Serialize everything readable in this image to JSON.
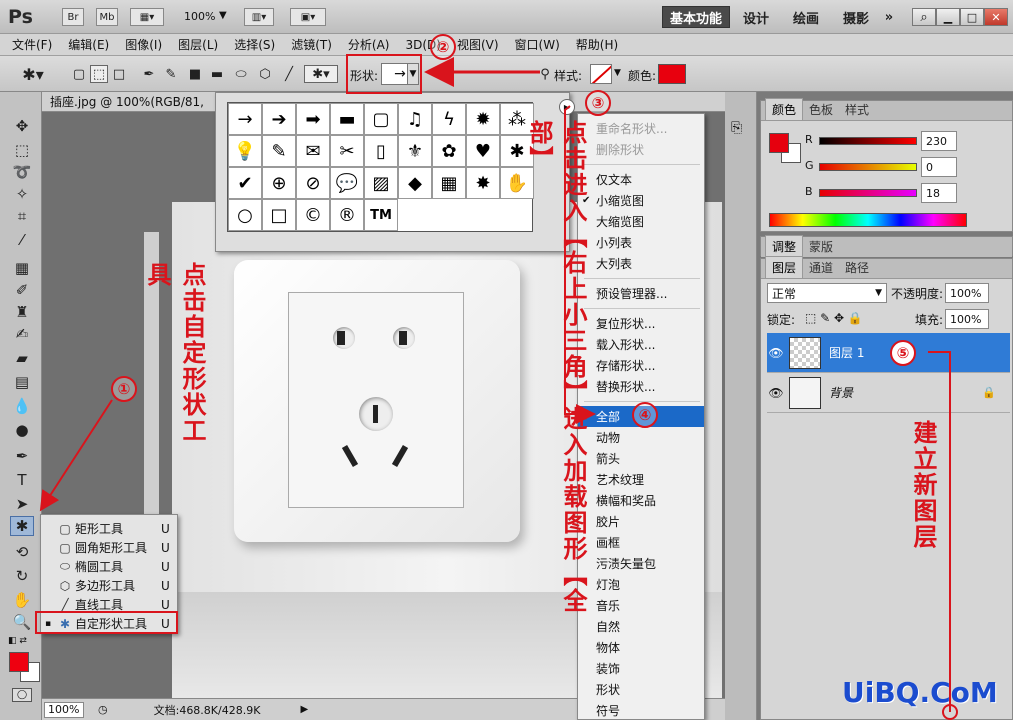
{
  "app": {
    "logo": "Ps",
    "bridge": "Br",
    "minibridge": "Mb",
    "zoom": "100%",
    "workspaces": [
      "基本功能",
      "设计",
      "绘画",
      "摄影"
    ],
    "more": "»"
  },
  "menu": [
    "文件(F)",
    "编辑(E)",
    "图像(I)",
    "图层(L)",
    "选择(S)",
    "滤镜(T)",
    "分析(A)",
    "3D(D)",
    "视图(V)",
    "窗口(W)",
    "帮助(H)"
  ],
  "options": {
    "shape_label": "形状:",
    "style_label": "样式:",
    "color_label": "颜色:",
    "color": "#e8000e"
  },
  "document": {
    "tab": "插座.jpg @ 100%(RGB/81,",
    "zoom": "100%",
    "doc_info": "文档:468.8K/428.9K"
  },
  "picker": {
    "shapes": [
      "→",
      "➔",
      "➡",
      "▬",
      "▢",
      "♫",
      "ϟ",
      "✹",
      "⁂",
      "💡",
      "✎",
      "✉",
      "✂",
      "▯",
      "⚜",
      "✿",
      "♥",
      "✱",
      "✔",
      "⊕",
      "⊘",
      "💬",
      "▨",
      "◆",
      "▦",
      "✸",
      "✋",
      "○",
      "□",
      "©",
      "®",
      "TM"
    ]
  },
  "context_menu": {
    "items": [
      {
        "label": "重命名形状...",
        "state": "disabled"
      },
      {
        "label": "删除形状",
        "state": "disabled"
      },
      {
        "label": "仅文本",
        "state": "normal"
      },
      {
        "label": "小缩览图",
        "state": "checked"
      },
      {
        "label": "大缩览图",
        "state": "normal"
      },
      {
        "label": "小列表",
        "state": "normal"
      },
      {
        "label": "大列表",
        "state": "normal"
      },
      {
        "label": "预设管理器...",
        "state": "normal"
      },
      {
        "label": "复位形状...",
        "state": "normal"
      },
      {
        "label": "载入形状...",
        "state": "normal"
      },
      {
        "label": "存储形状...",
        "state": "normal"
      },
      {
        "label": "替换形状...",
        "state": "normal"
      },
      {
        "label": "全部",
        "state": "selected"
      },
      {
        "label": "动物",
        "state": "normal"
      },
      {
        "label": "箭头",
        "state": "normal"
      },
      {
        "label": "艺术纹理",
        "state": "normal"
      },
      {
        "label": "横幅和奖品",
        "state": "normal"
      },
      {
        "label": "胶片",
        "state": "normal"
      },
      {
        "label": "画框",
        "state": "normal"
      },
      {
        "label": "污渍矢量包",
        "state": "normal"
      },
      {
        "label": "灯泡",
        "state": "normal"
      },
      {
        "label": "音乐",
        "state": "normal"
      },
      {
        "label": "自然",
        "state": "normal"
      },
      {
        "label": "物体",
        "state": "normal"
      },
      {
        "label": "装饰",
        "state": "normal"
      },
      {
        "label": "形状",
        "state": "normal"
      },
      {
        "label": "符号",
        "state": "normal"
      }
    ]
  },
  "color_panel": {
    "tabs": [
      "颜色",
      "色板",
      "样式"
    ],
    "r_label": "R",
    "g_label": "G",
    "b_label": "B",
    "r": "230",
    "g": "0",
    "b": "18",
    "fg": "#e6000e"
  },
  "adjust_panel": {
    "tabs": [
      "调整",
      "蒙版"
    ]
  },
  "layers_panel": {
    "tabs": [
      "图层",
      "通道",
      "路径"
    ],
    "blend": "正常",
    "opacity_label": "不透明度:",
    "opacity": "100%",
    "lock_label": "锁定:",
    "fill_label": "填充:",
    "fill": "100%",
    "layers": [
      {
        "name": "图层 1"
      },
      {
        "name": "背景"
      }
    ]
  },
  "flyout": {
    "items": [
      {
        "label": "矩形工具",
        "key": "U"
      },
      {
        "label": "圆角矩形工具",
        "key": "U"
      },
      {
        "label": "椭圆工具",
        "key": "U"
      },
      {
        "label": "多边形工具",
        "key": "U"
      },
      {
        "label": "直线工具",
        "key": "U"
      },
      {
        "label": "自定形状工具",
        "key": "U"
      }
    ]
  },
  "annotations": {
    "n1": "①",
    "n2": "②",
    "n3": "③",
    "n4": "④",
    "n5": "⑤",
    "text1": "点击自定形状工具",
    "text2": "点击进入【右上小三角】进入加载图形【全部】",
    "text3": "建立新图层",
    "watermark": "UiBQ.CoM"
  }
}
